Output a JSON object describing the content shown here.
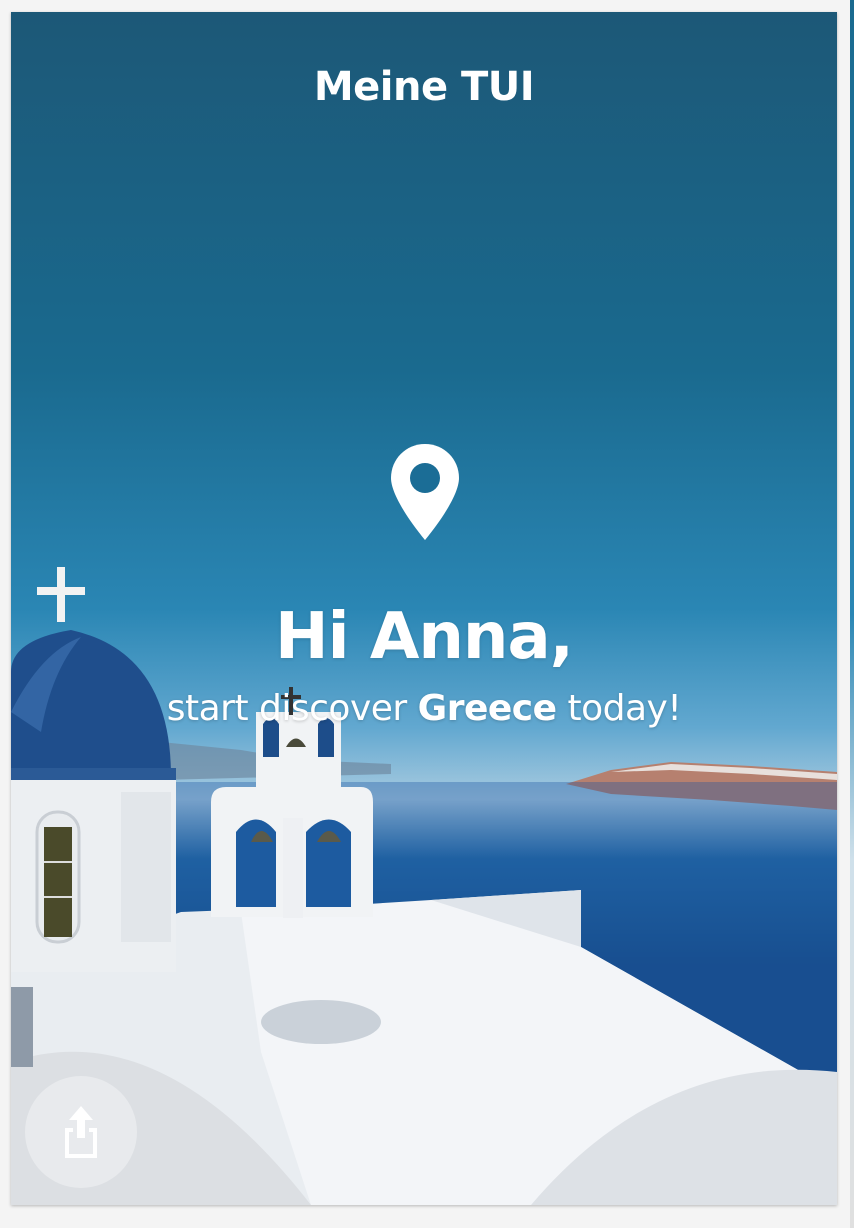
{
  "header": {
    "title": "Meine TUI"
  },
  "hero": {
    "pin_icon": "location-pin-icon",
    "greeting": "Hi Anna,",
    "sub_prefix": "start discover ",
    "sub_destination": "Greece",
    "sub_suffix": " today!"
  },
  "actions": {
    "share_icon": "share-icon"
  },
  "colors": {
    "sky_top": "#1c5877",
    "sea": "#174c87",
    "text": "#ffffff"
  }
}
